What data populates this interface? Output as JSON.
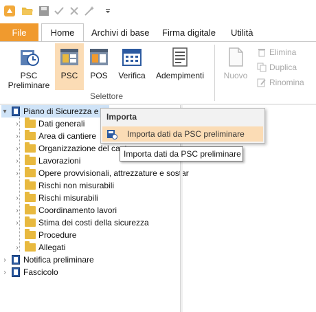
{
  "quick_access": {
    "icons": [
      "app-logo-icon",
      "open-folder-icon",
      "save-icon",
      "check-icon",
      "close-icon",
      "wand-icon",
      "customize-dropdown-icon"
    ]
  },
  "tabs": {
    "file": "File",
    "home": "Home",
    "archivi": "Archivi di base",
    "firma": "Firma digitale",
    "utilita": "Utilità"
  },
  "ribbon": {
    "psc_preliminare_line1": "PSC",
    "psc_preliminare_line2": "Preliminare",
    "psc": "PSC",
    "pos": "POS",
    "verifica": "Verifica",
    "adempimenti": "Adempimenti",
    "group_label": "Selettore",
    "nuovo": "Nuovo",
    "elimina": "Elimina",
    "duplica": "Duplica",
    "rinomina": "Rinomina"
  },
  "tree": {
    "root": "Piano di Sicurezza e C",
    "children": [
      "Dati generali",
      "Area di cantiere",
      "Organizzazione del cant",
      "Lavorazioni",
      "Opere provvisionali, attrezzature e sostar",
      "Rischi non misurabili",
      "Rischi misurabili",
      "Coordinamento lavori",
      "Stima dei costi della sicurezza",
      "Procedure",
      "Allegati"
    ],
    "notifica": "Notifica preliminare",
    "fascicolo": "Fascicolo"
  },
  "context_menu": {
    "title": "Importa",
    "item": "Importa dati da PSC preliminare"
  },
  "tooltip": "Importa dati da PSC preliminare",
  "colors": {
    "file_tab": "#f09a2e",
    "selected_bg": "#fbdcb5",
    "folder": "#e8b93f"
  }
}
